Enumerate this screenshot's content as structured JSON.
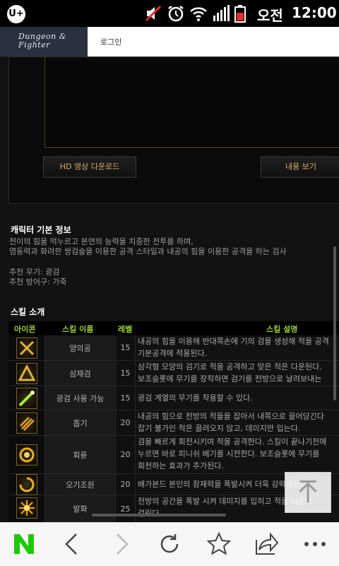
{
  "status_bar": {
    "carrier": "U+",
    "ampm": "오전",
    "time": "12:00",
    "icons": [
      "mute-icon",
      "alarm-icon",
      "wifi-icon",
      "signal-icon",
      "battery-icon"
    ]
  },
  "header": {
    "logo_text": "Dungeon & Fighter",
    "login_label": "로그인"
  },
  "video": {
    "hd_button": "HD 영상 다운로드",
    "view_button": "내용 보기"
  },
  "character": {
    "title": "캐릭터 기본 정보",
    "desc_lines": [
      "전이의 힘을 억누르고 본연의 능력을 치중한 전투를 하며,",
      "염동력과 화려한 쌍검술을 이용한 공격 스타일과 내공의 힘을 이용한 공격을 하는 검사"
    ],
    "weapon": "추천 무기: 광검",
    "armor": "추천 방어구: 가죽"
  },
  "skills": {
    "title": "스킬 소개",
    "headers": {
      "icon": "아이콘",
      "name": "스킬 이름",
      "level": "레벨",
      "desc": "스킬 설명"
    },
    "rows": [
      {
        "name": "양의공",
        "level": "15",
        "icon": "cross-slash-icon",
        "desc": [
          "내공의 힘을 이용해 반대쪽손에 기의 검을 생성해 적을 공격",
          "기본공격에 적용된다."
        ]
      },
      {
        "name": "삼재검",
        "level": "15",
        "icon": "triangle-blade-icon",
        "desc": [
          "삼각형 모양의 검기로 적을 공격하고 맞은 적은 다운된다.",
          "보조슬롯에 무기를 장착하면 검기를 전방으로 날려보내는"
        ]
      },
      {
        "name": "광검 사용 가능",
        "level": "15",
        "icon": "light-sword-icon",
        "desc": [
          "광검 계열의 무기를 착용할 수 있다."
        ]
      },
      {
        "name": "흡기",
        "level": "20",
        "icon": "grab-hand-icon",
        "desc": [
          "내공의 힘으로 전방의 적들을 잡아서 내쪽으로 끌어당긴다",
          "잡기 불가인 적은 끌려오지 않고, 데미지만 입는다."
        ]
      },
      {
        "name": "회륜",
        "level": "20",
        "icon": "spin-ring-icon",
        "desc": [
          "검을 빠르게 회전시키며 적을 공격한다. 스킬이 끝나기전에",
          "누르면 바로 피니쉬 베기를 시전한다. 보조슬롯에 무기를",
          "회전하는 효과가 추가된다."
        ]
      },
      {
        "name": "오기조원",
        "level": "20",
        "icon": "swirl-icon",
        "desc": [
          "배가본드 본인의 잠재력을 폭발시켜 더욱 강력해진다"
        ]
      },
      {
        "name": "발화",
        "level": "25",
        "icon": "burst-icon",
        "desc": [
          "전방의 공간을 폭발 시켜 데미지를 입히고 적을 띄운다",
          "걸린다."
        ]
      }
    ]
  },
  "bottom_bar": {
    "items": [
      "naver-icon",
      "back-icon",
      "forward-icon",
      "refresh-icon",
      "bookmark-star-icon",
      "share-icon",
      "more-icon"
    ]
  },
  "colors": {
    "accent_green": "#9ed132",
    "button_text": "#d9a86a",
    "page_bg": "#121212",
    "naver_green": "#1ec800"
  }
}
